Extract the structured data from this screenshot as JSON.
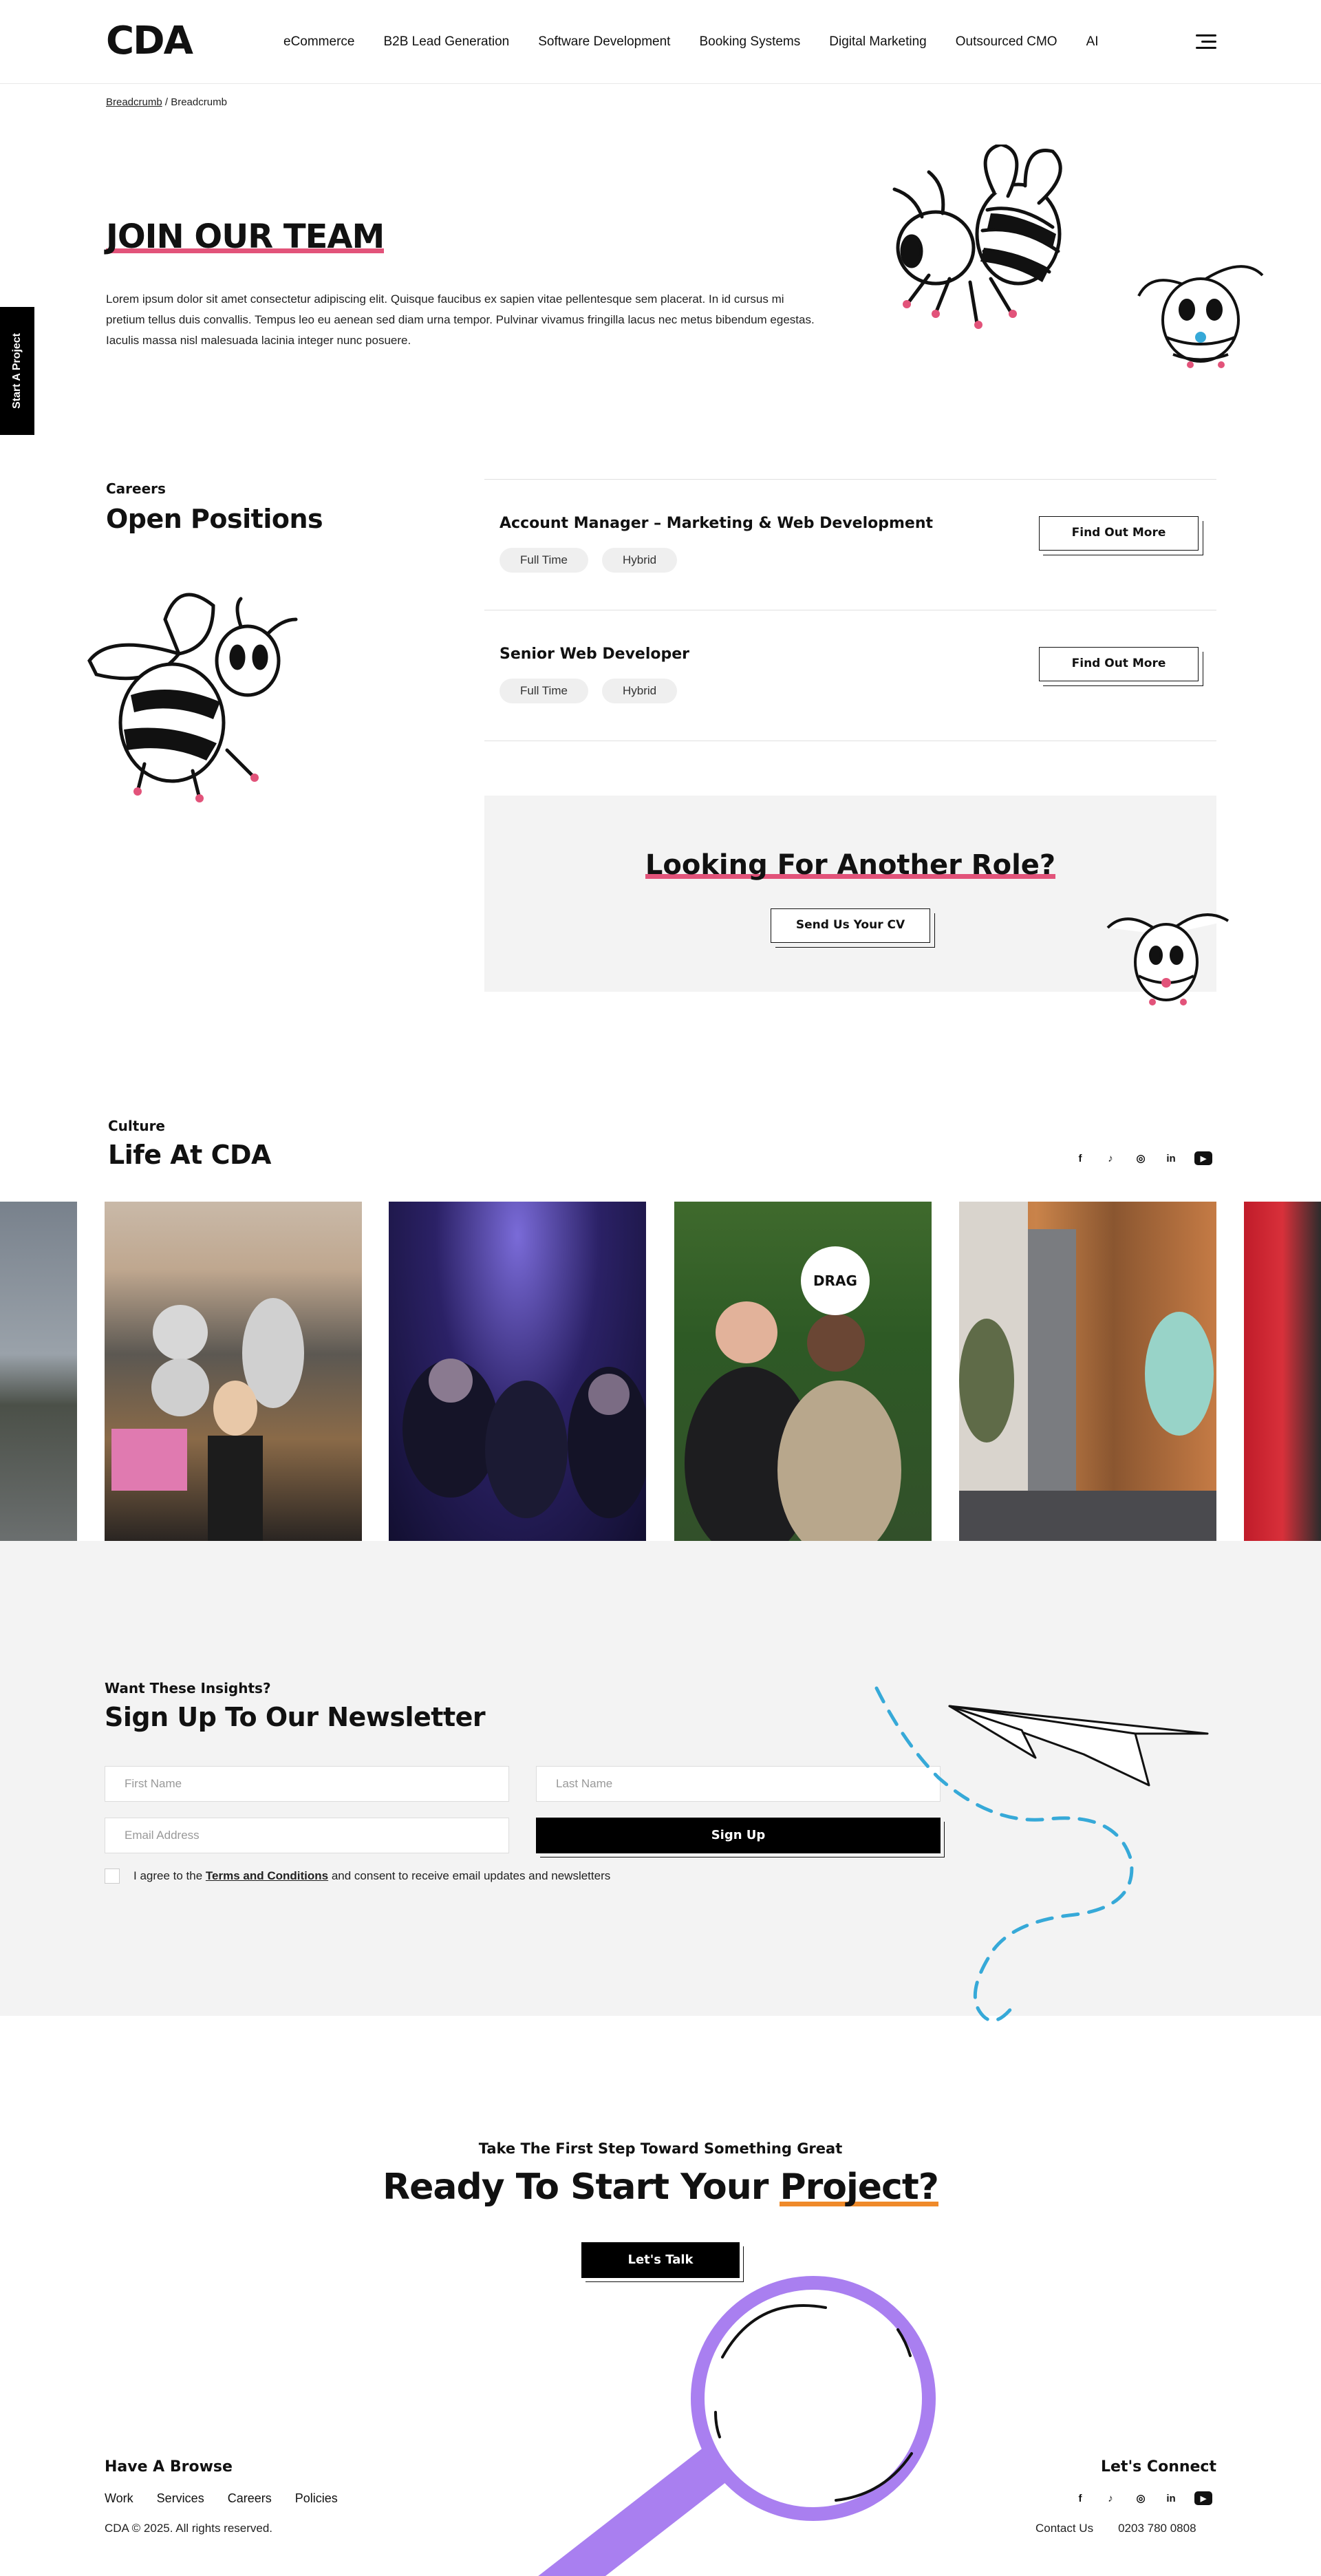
{
  "header": {
    "logo": "CDA",
    "nav": [
      "eCommerce",
      "B2B Lead Generation",
      "Software Development",
      "Booking Systems",
      "Digital Marketing",
      "Outsourced CMO",
      "AI"
    ],
    "menu_icon": "hamburger-icon"
  },
  "breadcrumb": {
    "link": "Breadcrumb",
    "separator": " / ",
    "current": "Breadcrumb"
  },
  "side_tab": {
    "label": "Start A Project"
  },
  "hero": {
    "title": "JOIN OUR TEAM",
    "text": "Lorem ipsum dolor sit amet consectetur adipiscing elit. Quisque faucibus ex sapien vitae pellentesque sem placerat. In id cursus mi pretium tellus duis convallis. Tempus leo eu aenean sed diam urna tempor. Pulvinar vivamus fringilla lacus nec metus bibendum egestas. Iaculis massa nisl malesuada lacinia integer nunc posuere."
  },
  "careers": {
    "eyebrow": "Careers",
    "title": "Open Positions",
    "jobs": [
      {
        "title": "Account Manager – Marketing & Web Development",
        "tags": [
          "Full Time",
          "Hybrid"
        ],
        "button": "Find Out More"
      },
      {
        "title": "Senior Web Developer",
        "tags": [
          "Full Time",
          "Hybrid"
        ],
        "button": "Find Out More"
      }
    ],
    "cv": {
      "title": "Looking For Another Role?",
      "button": "Send Us Your CV"
    }
  },
  "culture": {
    "eyebrow": "Culture",
    "title": "Life At CDA",
    "social": [
      "f",
      "♪",
      "◎",
      "in",
      "▶"
    ],
    "drag_label": "DRAG"
  },
  "newsletter": {
    "eyebrow": "Want These Insights?",
    "title": "Sign Up To Our Newsletter",
    "first_name_placeholder": "First Name",
    "last_name_placeholder": "Last Name",
    "email_placeholder": "Email Address",
    "button": "Sign Up",
    "agree_prefix": "I agree to the ",
    "agree_link": "Terms and Conditions",
    "agree_suffix": " and consent to receive email updates and newsletters"
  },
  "cta": {
    "eyebrow": "Take The First Step Toward Something Great",
    "title_prefix": "Ready To Start Your ",
    "title_highlight": "Project?",
    "button": "Let's Talk"
  },
  "footer": {
    "browse_title": "Have A Browse",
    "links": [
      "Work",
      "Services",
      "Careers",
      "Policies"
    ],
    "copyright": "CDA © 2025. All rights reserved.",
    "connect_title": "Let's Connect",
    "social": [
      "f",
      "♪",
      "◎",
      "in",
      "▶"
    ],
    "contact": "Contact Us",
    "phone": "0203 780 0808"
  },
  "colors": {
    "accent_pink": "#e2537a",
    "accent_orange": "#ef8a2a",
    "accent_purple": "#a97ff0",
    "accent_blue": "#36a9d8"
  }
}
